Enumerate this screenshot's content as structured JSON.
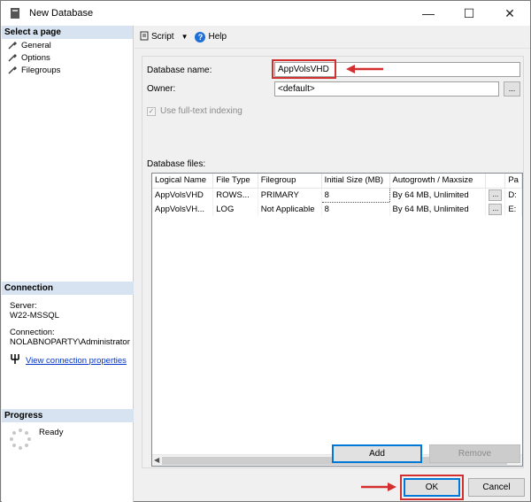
{
  "window": {
    "title": "New Database"
  },
  "nav": {
    "header": "Select a page",
    "items": [
      {
        "label": "General"
      },
      {
        "label": "Options"
      },
      {
        "label": "Filegroups"
      }
    ]
  },
  "connection": {
    "header": "Connection",
    "server_label": "Server:",
    "server_value": "W22-MSSQL",
    "connection_label": "Connection:",
    "connection_value": "NOLABNOPARTY\\Administrator",
    "link": "View connection properties"
  },
  "progress": {
    "header": "Progress",
    "status": "Ready"
  },
  "toolbar": {
    "script_label": "Script",
    "help_label": "Help"
  },
  "form": {
    "dbname_label": "Database name:",
    "dbname_value": "AppVolsVHD",
    "owner_label": "Owner:",
    "owner_value": "<default>",
    "fulltext_label": "Use full-text indexing",
    "dbfiles_label": "Database files:"
  },
  "files_table": {
    "headers": [
      "Logical Name",
      "File Type",
      "Filegroup",
      "Initial Size (MB)",
      "Autogrowth / Maxsize",
      "",
      "Pa"
    ],
    "rows": [
      [
        "AppVolsVHD",
        "ROWS...",
        "PRIMARY",
        "8",
        "By 64 MB, Unlimited",
        "...",
        "D:"
      ],
      [
        "AppVolsVH...",
        "LOG",
        "Not Applicable",
        "8",
        "By 64 MB, Unlimited",
        "...",
        "E:"
      ]
    ]
  },
  "buttons": {
    "add": "Add",
    "remove": "Remove",
    "ok": "OK",
    "cancel": "Cancel",
    "ellipsis": "..."
  },
  "colors": {
    "accent": "#0078d7",
    "highlight": "#d32f2f",
    "header_bg": "#d7e3f0"
  }
}
